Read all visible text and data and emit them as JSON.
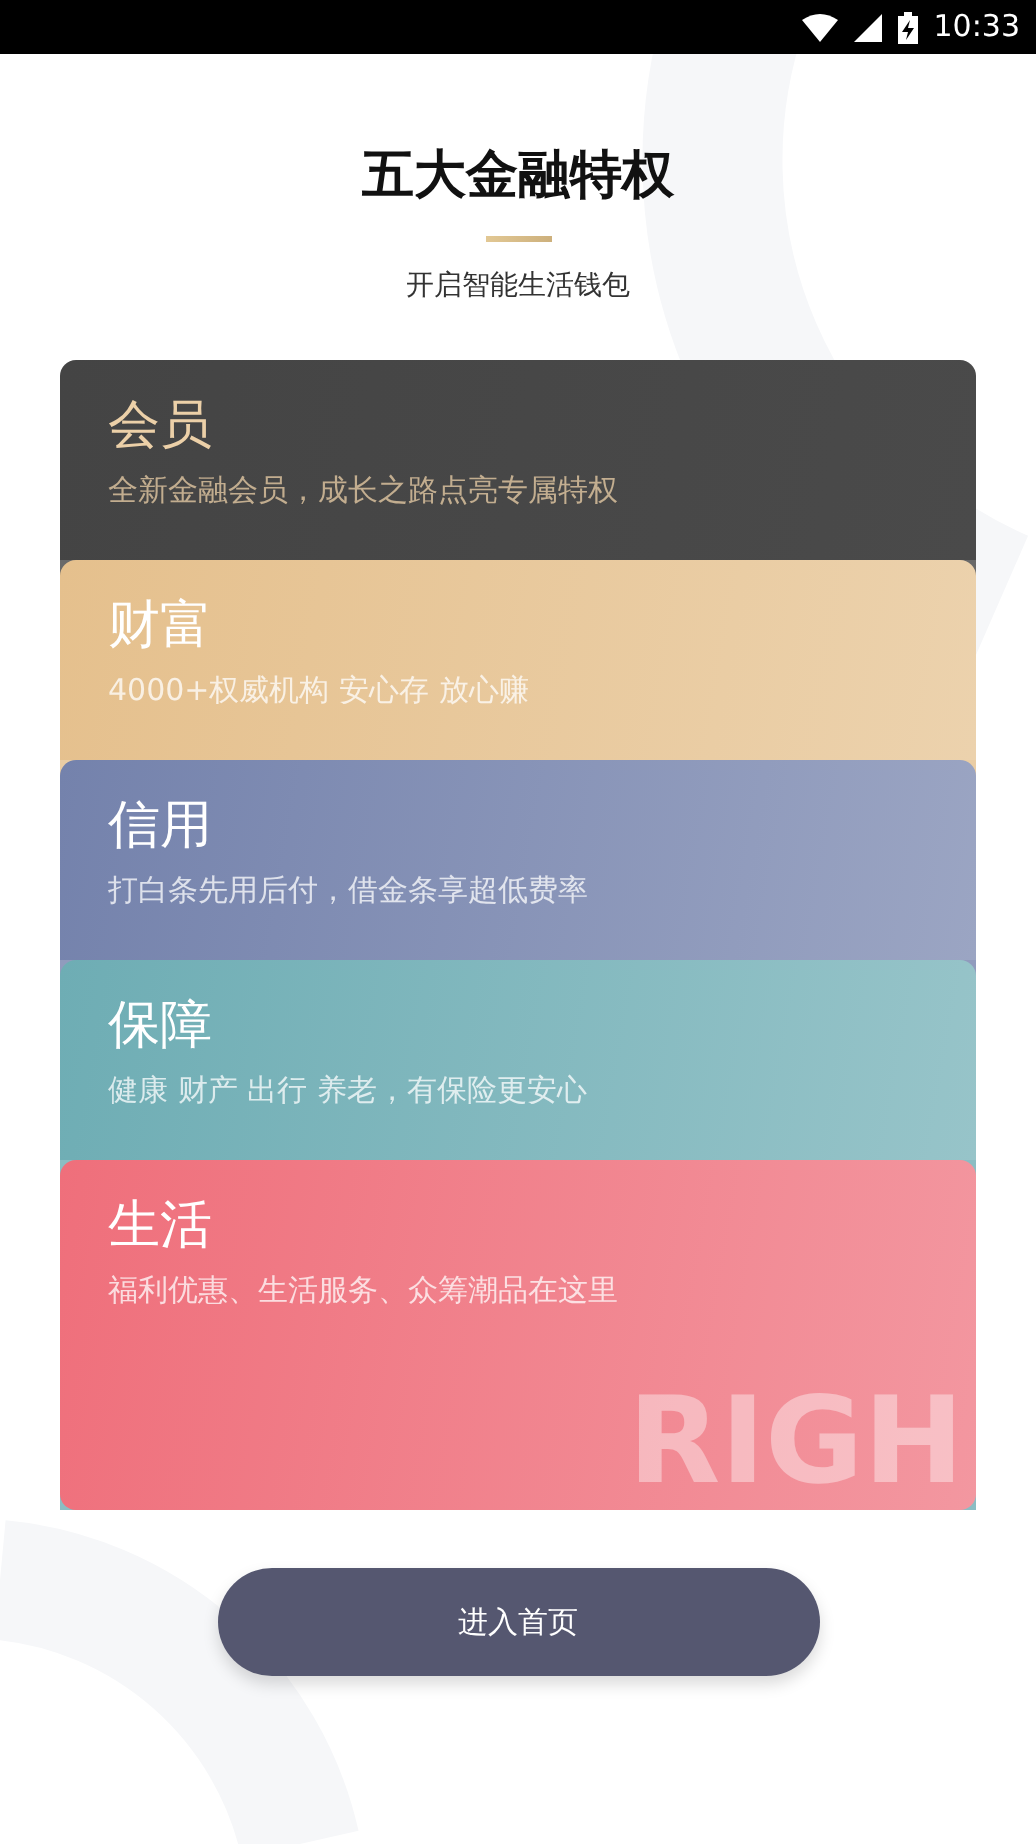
{
  "status_bar": {
    "time": "10:33"
  },
  "header": {
    "title": "五大金融特权",
    "subtitle": "开启智能生活钱包"
  },
  "cards": [
    {
      "kind": "dark",
      "title": "会员",
      "description": "全新金融会员，成长之路点亮专属特权",
      "color": "#444444"
    },
    {
      "kind": "light",
      "title": "财富",
      "description": "4000+权威机构 安心存 放心赚",
      "color": "#e5c08d"
    },
    {
      "kind": "light",
      "title": "信用",
      "description": "打白条先用后付，借金条享超低费率",
      "color": "#7482ac"
    },
    {
      "kind": "light",
      "title": "保障",
      "description": "健康 财产 出行 养老，有保险更安心",
      "color": "#6eadb4"
    },
    {
      "kind": "light",
      "title": "生活",
      "description": "福利优惠、生活服务、众筹潮品在这里",
      "color": "#ef6f7b",
      "backdrop_text": "RIGH"
    }
  ],
  "enter_button": "进入首页"
}
